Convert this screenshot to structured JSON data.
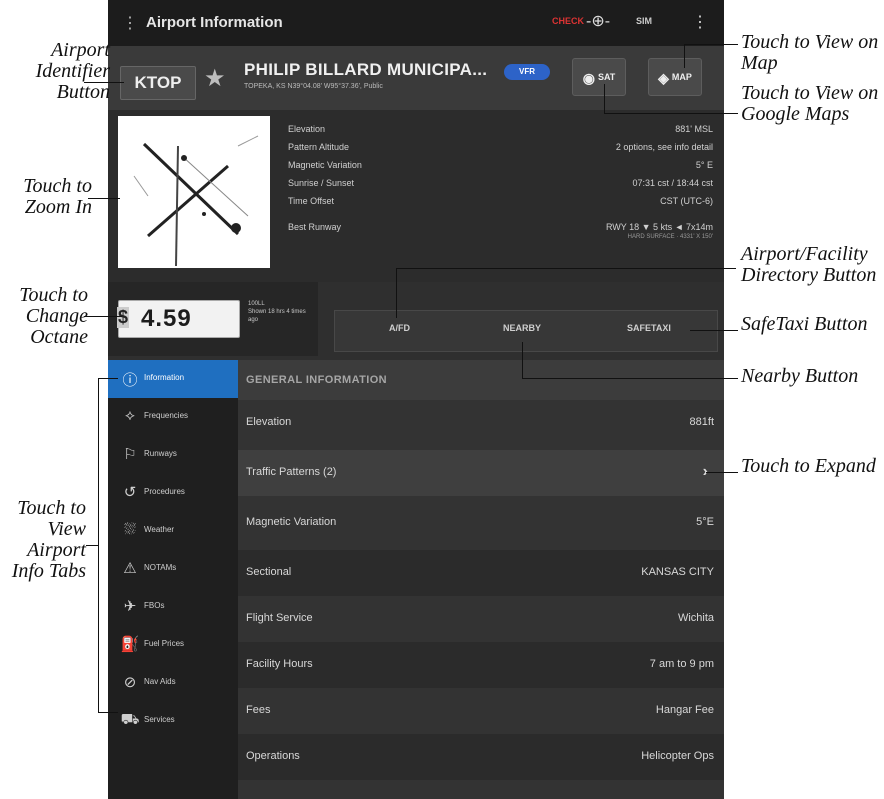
{
  "app": {
    "title": "Airport Information",
    "status_alert": "CHECK",
    "status_gps_icon": "gps-icon",
    "status_sim": "SIM",
    "more_icon": "more-vert-icon"
  },
  "header": {
    "identifier": "KTOP",
    "name": "PHILIP BILLARD MUNICIPA...",
    "subtitle": "TOPEKA, KS N39°04.08' W95°37.36', Public",
    "wx_badge": "VFR",
    "sat_label": "SAT",
    "map_label": "MAP"
  },
  "details": [
    {
      "label": "Elevation",
      "value": "881' MSL"
    },
    {
      "label": "Pattern Altitude",
      "value": "2 options, see info detail"
    },
    {
      "label": "Magnetic Variation",
      "value": "5° E"
    },
    {
      "label": "Sunrise / Sunset",
      "value": "07:31 cst / 18:44 cst"
    },
    {
      "label": "Time Offset",
      "value": "CST (UTC-6)"
    },
    {
      "label": "Best Runway",
      "value": "RWY 18 ▼ 5 kts ◄ 7x14m",
      "sub": "HARD SURFACE · 4331' X 150'"
    }
  ],
  "fuel": {
    "currency": "$",
    "price": "4.59",
    "name": "100LL",
    "detail": "Shown 18 hrs 4 times ago"
  },
  "actions": {
    "afd": "A/FD",
    "nearby": "NEARBY",
    "safetaxi": "SAFETAXI"
  },
  "tabs": [
    {
      "label": "Information",
      "icon": "ⓘ",
      "active": true
    },
    {
      "label": "Frequencies",
      "icon": "⟡",
      "active": false
    },
    {
      "label": "Runways",
      "icon": "⚐",
      "active": false
    },
    {
      "label": "Procedures",
      "icon": "↺",
      "active": false
    },
    {
      "label": "Weather",
      "icon": "⛆",
      "active": false
    },
    {
      "label": "NOTAMs",
      "icon": "⚠",
      "active": false
    },
    {
      "label": "FBOs",
      "icon": "✈",
      "active": false
    },
    {
      "label": "Fuel Prices",
      "icon": "⛽",
      "active": false
    },
    {
      "label": "Nav Aids",
      "icon": "⊘",
      "active": false
    },
    {
      "label": "Services",
      "icon": "⛟",
      "active": false
    }
  ],
  "general": {
    "heading": "GENERAL INFORMATION",
    "rows": [
      {
        "label": "Elevation",
        "value": "881ft"
      },
      {
        "label": "Traffic Patterns (2)",
        "value": ""
      },
      {
        "label": "Magnetic Variation",
        "value": "5°E"
      },
      {
        "label": "Sectional",
        "value": "KANSAS CITY"
      },
      {
        "label": "Flight Service",
        "value": "Wichita"
      },
      {
        "label": "Facility Hours",
        "value": "7 am to 9 pm"
      },
      {
        "label": "Fees",
        "value": "Hangar Fee"
      },
      {
        "label": "Operations",
        "value": "Helicopter Ops"
      }
    ]
  },
  "callouts": {
    "airport_id": "Airport Identifier Button",
    "zoom": "Touch to Zoom In",
    "octane": "Touch to Change Octane",
    "view_tabs": "Touch to View Airport Info Tabs",
    "view_map": "Touch to View on Map",
    "google_maps": "Touch to View on Google Maps",
    "afd": "Airport/Facility Directory Button",
    "safetaxi": "SafeTaxi Button",
    "nearby": "Nearby Button",
    "expand": "Touch to Expand"
  }
}
